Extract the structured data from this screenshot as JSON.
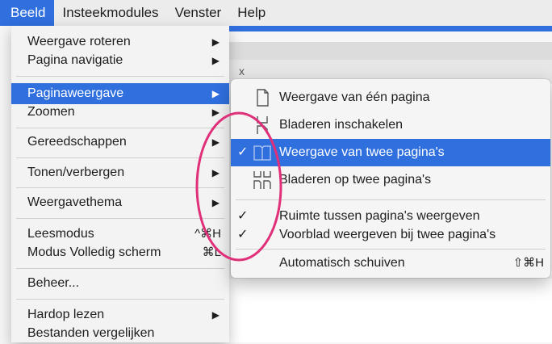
{
  "menubar": {
    "items": [
      "Beeld",
      "Insteekmodules",
      "Venster",
      "Help"
    ]
  },
  "menu": {
    "items": {
      "rotate": "Weergave roteren",
      "page_nav": "Pagina navigatie",
      "page_display": "Paginaweergave",
      "zoom": "Zoomen",
      "tools": "Gereedschappen",
      "show_hide": "Tonen/verbergen",
      "theme": "Weergavethema",
      "read_mode": "Leesmodus",
      "read_mode_shortcut": "^⌘H",
      "fullscreen": "Modus Volledig scherm",
      "fullscreen_shortcut": "⌘L",
      "manage": "Beheer...",
      "read_aloud": "Hardop lezen",
      "compare": "Bestanden vergelijken"
    },
    "arrow": "▶"
  },
  "submenu": {
    "single_page": "Weergave van één pagina",
    "enable_scroll": "Bladeren inschakelen",
    "two_page": "Weergave van twee pagina's",
    "two_page_scroll": "Bladeren op twee pagina's",
    "gaps": "Ruimte tussen pagina's weergeven",
    "cover": "Voorblad weergeven bij twee pagina's",
    "auto_scroll": "Automatisch schuiven",
    "auto_scroll_shortcut": "⇧⌘H",
    "check": "✓"
  },
  "background": {
    "tab_close": "x"
  },
  "colors": {
    "accent": "#2f6fde",
    "annotation": "#e0307a"
  }
}
